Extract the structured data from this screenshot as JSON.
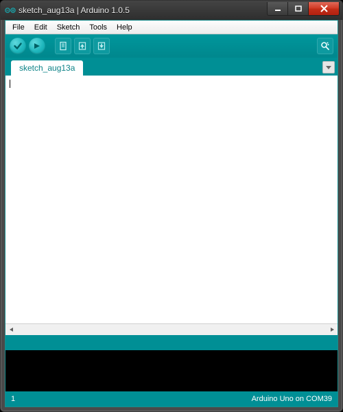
{
  "window": {
    "title": "sketch_aug13a | Arduino 1.0.5"
  },
  "menu": {
    "file": "File",
    "edit": "Edit",
    "sketch": "Sketch",
    "tools": "Tools",
    "help": "Help"
  },
  "toolbar": {
    "verify": "verify",
    "upload": "upload",
    "new": "new",
    "open": "open",
    "save": "save",
    "serial_monitor": "serial-monitor"
  },
  "tabs": {
    "items": [
      {
        "label": "sketch_aug13a"
      }
    ]
  },
  "editor": {
    "content": ""
  },
  "status": {
    "line": "1",
    "board": "Arduino Uno on COM39"
  },
  "colors": {
    "teal": "#008f95",
    "teal_light": "#1fb7bd"
  }
}
